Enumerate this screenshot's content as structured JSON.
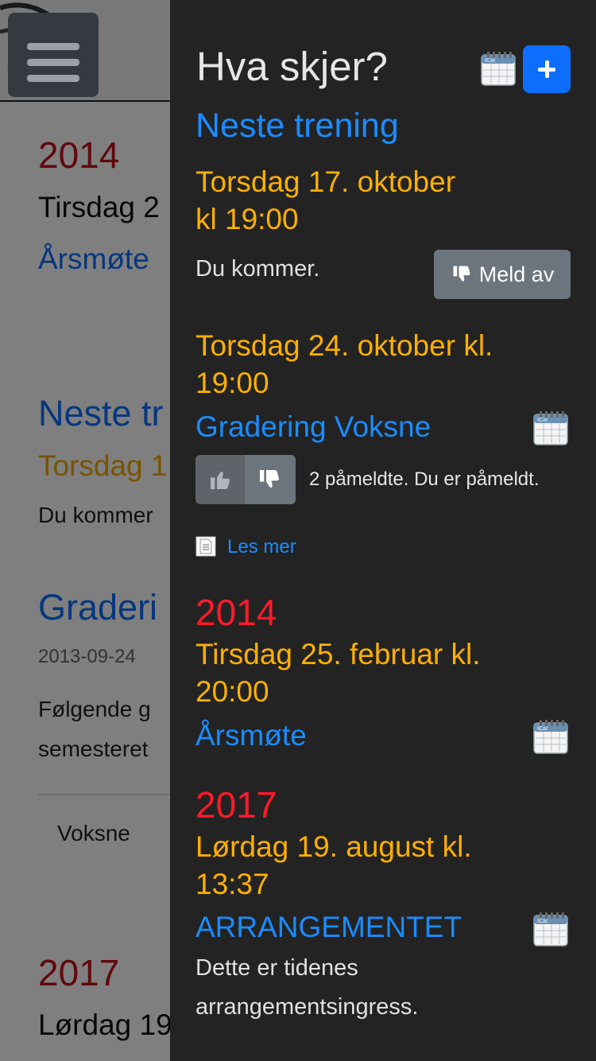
{
  "background": {
    "year_2014": "2014",
    "date_2014": "Tirsdag 2",
    "event_2014": "Årsmøte",
    "neste_heading": "Neste tr",
    "neste_date": "Torsdag 1",
    "neste_status": "Du kommer",
    "gradering_heading": "Graderi",
    "gradering_date": "2013-09-24",
    "gradering_text_1": "Følgende g",
    "gradering_text_2": "semesteret",
    "table_cell": "Voksne",
    "year_2017": "2017",
    "date_2017": "Lørdag 19"
  },
  "drawer": {
    "title": "Hva skjer?",
    "neste_trening": {
      "heading": "Neste trening",
      "date_line1": "Torsdag 17. oktober",
      "date_line2": "kl 19:00",
      "status": "Du kommer.",
      "meld_av_label": "Meld av"
    },
    "gradering": {
      "date_line1": "Torsdag 24. oktober kl.",
      "date_line2": "19:00",
      "title": "Gradering Voksne",
      "signup_text": "2 påmeldte. Du er påmeldt.",
      "les_mer": "Les mer"
    },
    "arsmote": {
      "year": "2014",
      "date_line1": "Tirsdag 25. februar kl.",
      "date_line2": "20:00",
      "title": "Årsmøte"
    },
    "arrangement": {
      "year": "2017",
      "date_line1": "Lørdag 19. august kl.",
      "date_line2": "13:37",
      "title": "ARRANGEMENTET",
      "text_line1": "Dette er tidenes",
      "text_line2": "arrangementsingress."
    }
  },
  "colors": {
    "drawer_bg": "#232323",
    "accent_blue": "#1a8cff",
    "date_orange": "#ffb000",
    "year_red": "#ff1a2a",
    "button_grey": "#6c757d",
    "primary_button": "#0d6efd"
  },
  "icons": [
    "hamburger-icon",
    "ical-calendar-icon",
    "plus-icon",
    "thumbs-down-icon",
    "thumbs-up-icon",
    "document-icon"
  ]
}
